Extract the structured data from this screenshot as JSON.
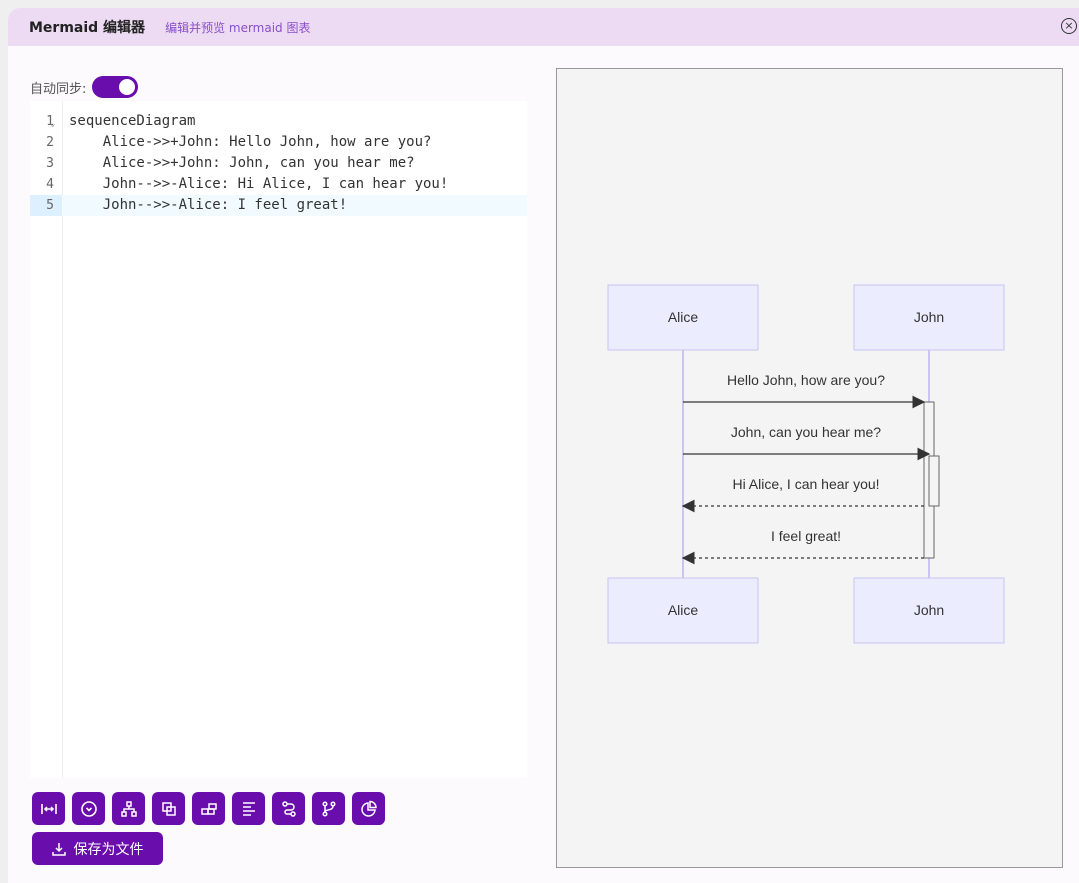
{
  "header": {
    "title": "Mermaid 编辑器",
    "subtitle": "编辑并预览 mermaid 图表"
  },
  "sync": {
    "label": "自动同步:",
    "enabled": true
  },
  "editor": {
    "lines": [
      {
        "n": "1",
        "text": "sequenceDiagram"
      },
      {
        "n": "2",
        "text": "    Alice->>+John: Hello John, how are you?"
      },
      {
        "n": "3",
        "text": "    Alice->>+John: John, can you hear me?"
      },
      {
        "n": "4",
        "text": "    John-->>-Alice: Hi Alice, I can hear you!"
      },
      {
        "n": "5",
        "text": "    John-->>-Alice: I feel great!"
      }
    ],
    "active_line": 5
  },
  "toolbar": {
    "icons": [
      "sequence-icon",
      "state-icon",
      "flowchart-icon",
      "class-icon",
      "er-icon",
      "gantt-icon",
      "journey-icon",
      "git-icon",
      "pie-icon"
    ],
    "save_label": "保存为文件"
  },
  "diagram": {
    "participants": [
      "Alice",
      "John"
    ],
    "messages": [
      {
        "from": "Alice",
        "to": "John",
        "text": "Hello John, how are you?",
        "dashed": false
      },
      {
        "from": "Alice",
        "to": "John",
        "text": "John, can you hear me?",
        "dashed": false
      },
      {
        "from": "John",
        "to": "Alice",
        "text": "Hi Alice, I can hear you!",
        "dashed": true
      },
      {
        "from": "John",
        "to": "Alice",
        "text": "I feel great!",
        "dashed": true
      }
    ]
  }
}
